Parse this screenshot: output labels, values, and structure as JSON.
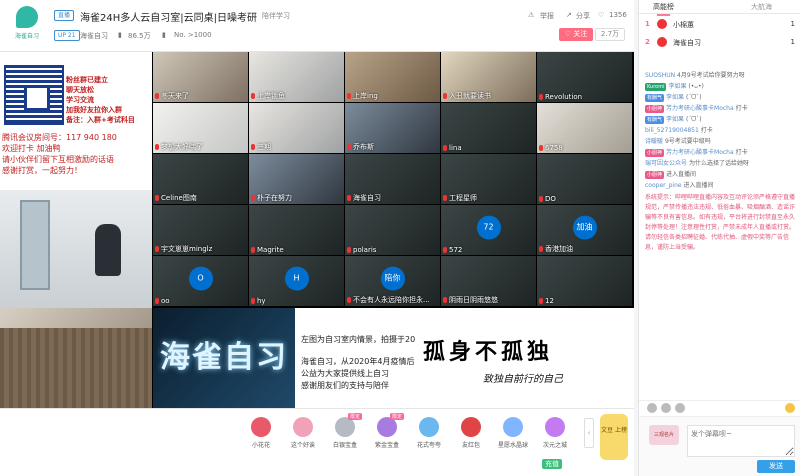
{
  "header": {
    "logo_text": "海雀自习",
    "live_tag": "直播",
    "title": "海雀24H多人云自习室|云同桌|日噪考研",
    "category": "陪伴学习",
    "up_level": "UP 21",
    "streamer": "海雀自习",
    "popularity": "86.5万",
    "rank": "No. >1000",
    "report": "举报",
    "share": "分享",
    "likes": "1356",
    "follow": "关注",
    "followers": "2.7万"
  },
  "left_panel": {
    "promo_lines": [
      "粉丝群已建立",
      "聊天放松",
      "学习交流",
      "加我好友拉你入群",
      "备注：入群+考试科目"
    ],
    "info_lines": [
      "腾讯会议房间号：117 940 180",
      "欢迎打卡  加油鸭",
      "请小伙伴们留下互相激励的话语",
      "感谢打赏，一起努力！"
    ]
  },
  "grid": [
    {
      "label": "冬天来了",
      "style": "v1"
    },
    {
      "label": "上岸锁鱼",
      "style": "v2"
    },
    {
      "label": "上岸ing",
      "style": "v3"
    },
    {
      "label": "入丑就要读书",
      "style": "v4"
    },
    {
      "label": "Revolution",
      "style": "v5"
    },
    {
      "label": "梦想大好喘了",
      "style": "v6"
    },
    {
      "label": "三期",
      "style": "v2"
    },
    {
      "label": "乔布斯",
      "style": "v7"
    },
    {
      "label": "lina",
      "style": "v5"
    },
    {
      "label": "6758",
      "style": "v8"
    },
    {
      "label": "Celine图南",
      "style": "v5"
    },
    {
      "label": "朴子在努力",
      "style": "v7"
    },
    {
      "label": "海雀自习",
      "style": "v5"
    },
    {
      "label": "工程星师",
      "style": "v5"
    },
    {
      "label": "DO",
      "style": "v5"
    },
    {
      "label": "宇文崽崽minglz",
      "style": "v5"
    },
    {
      "label": "Magrite",
      "style": "v5"
    },
    {
      "label": "polaris",
      "style": "v5"
    },
    {
      "label": "572",
      "style": "v5",
      "avatar": "72"
    },
    {
      "label": "香港加油",
      "style": "v5",
      "avatar": "加油"
    },
    {
      "label": "oo",
      "style": "v5",
      "avatar": "O"
    },
    {
      "label": "hy",
      "style": "v5",
      "avatar": "H"
    },
    {
      "label": "不会有人永远陪你担永...",
      "style": "v5",
      "avatar": "陪你"
    },
    {
      "label": "阴雨日阴雨悠悠",
      "style": "v5"
    },
    {
      "label": "12",
      "style": "v5"
    }
  ],
  "banner": {
    "neon_text": "海雀自习",
    "caption1": "左图为自习室内情景，拍摄于20",
    "caption2": "海雀自习，从2020年4月疫情后",
    "caption3": "公益为大家提供线上自习",
    "caption4": "感谢朋友们的支持与陪伴",
    "big_text": "孤身不孤独",
    "sub_text": "致独自前行的自己"
  },
  "gifts": [
    {
      "label": "小花花",
      "color": "#e85a6a"
    },
    {
      "label": "这个好诶",
      "color": "#f2a2b8"
    },
    {
      "label": "白银宝盒",
      "color": "#b5bac4",
      "badge": "限定"
    },
    {
      "label": "紫金宝盒",
      "color": "#a77be0",
      "badge": "限定"
    },
    {
      "label": "花式夸夸",
      "color": "#6bb7f0"
    },
    {
      "label": "友红包",
      "color": "#e04545"
    },
    {
      "label": "星愿水晶球",
      "color": "#7fb6ff"
    },
    {
      "label": "次元之城",
      "color": "#c27bf0"
    }
  ],
  "gift_side": {
    "rank_text": "文豆 上榜",
    "reward_text": "大航海 充值",
    "pay": "充值"
  },
  "sidebar": {
    "tab_rank": "高能榜",
    "tab_fleet": "大航海",
    "ranks": [
      {
        "num": "1",
        "name": "小棉蕙",
        "count": "1"
      },
      {
        "num": "2",
        "name": "海雀自习",
        "count": "1"
      }
    ],
    "chat": [
      {
        "name": "SUOSHUN",
        "text": "4月9号考试给你要努力呀",
        "badge": ""
      },
      {
        "name": "李如果",
        "text": "(•ᴗ•)",
        "badge": "Kuromi"
      },
      {
        "name": "李如果",
        "text": "(ˊᗜˋ)",
        "badge": "有酬气"
      },
      {
        "name": "芳力考研心酸事卡Mocha",
        "text": "打卡",
        "badge": "小厨神"
      },
      {
        "name": "李如果",
        "text": "(ˊᗜˋ)",
        "badge": "有酬气"
      },
      {
        "name": "bili_52719004851",
        "text": "打卡",
        "badge": ""
      },
      {
        "name": "诗暖暖",
        "text": "9号考试要中级吗",
        "badge": ""
      },
      {
        "name": "芳力考研心酸事卡Mocha",
        "text": "打卡",
        "badge": "小厨神"
      },
      {
        "name": "瑞可因女公众号",
        "text": "为什么选择了话给她呀",
        "badge": ""
      },
      {
        "name": "",
        "text": "进入直播间",
        "badge": "小厨神"
      },
      {
        "name": "cooper_pine",
        "text": "进入直播间",
        "badge": ""
      }
    ],
    "notice": "系统提示：哔哩哔哩直播内容及互动评论须严格遵守直播规范，严禁传播违法违规、低俗血暴、吸烟酗酒、造谣诈骗等不良有害信息。如有违规，平台将进行封禁直至永久封停等处理！注意理性打赏，严禁未成年人直播或打赏。请勿轻信各类招聘征婚、代练代抽、虚假中奖等广告信息，谨防上当受骗。",
    "input_placeholder": "发个弹幕呗~",
    "send": "发送",
    "card": "三观名片"
  }
}
